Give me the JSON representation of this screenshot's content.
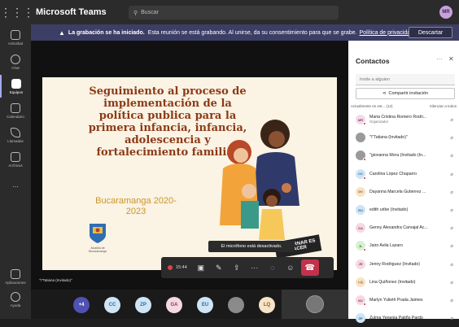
{
  "app": {
    "title": "Microsoft Teams",
    "search_placeholder": "Buscar",
    "user_initials": "MR"
  },
  "rail": [
    {
      "label": "Actividad"
    },
    {
      "label": "Chat"
    },
    {
      "label": "Equipos"
    },
    {
      "label": "Calendario"
    },
    {
      "label": "Llamadas"
    },
    {
      "label": "Archivos"
    },
    {
      "label": "..."
    }
  ],
  "rail_bottom": [
    {
      "label": "Aplicaciones"
    },
    {
      "label": "Ayuda"
    }
  ],
  "banner": {
    "bold": "La grabación se ha iniciado.",
    "text": "Esta reunión se está grabando. Al unirse, da su consentimiento para que se grabe.",
    "link": "Política de privacidad",
    "button": "Descartar"
  },
  "slide": {
    "title": "Seguimiento al proceso de implementación de la política publica para la primera infancia, infancia, adolescencia y fortalecimiento familiar",
    "subtitle": "Bucaramanga 2020-2023",
    "crest_label": "Alcaldía de Bucaramanga",
    "gob": "GOBERNAR ES HACER"
  },
  "toast": "El micrófono está desactivado.",
  "controls": {
    "timer": "15:44"
  },
  "caption": "\"\\\"Tatiana (Invitado)\"",
  "strip": [
    {
      "label": "+4",
      "color": "#4f52b2"
    },
    {
      "label": "CC",
      "color": "#cfe4f4"
    },
    {
      "label": "ZP",
      "color": "#cfe4f4"
    },
    {
      "label": "GA",
      "color": "#f4d9e2"
    },
    {
      "label": "EU",
      "color": "#cfe4f4"
    },
    {
      "label": "",
      "color": "#8a8a8a"
    },
    {
      "label": "LQ",
      "color": "#f7e3c7"
    }
  ],
  "panel": {
    "title": "Contactos",
    "invite_placeholder": "Invite a alguien",
    "share_label": "Compartir invitación",
    "section_label": "Actualmente en est... (12)",
    "mute_all": "Silenciar a todos",
    "people": [
      {
        "initials": "MR",
        "name": "Maria Cristina Romero Rodri...",
        "role": "Organizador",
        "bg": "#f0dbe8",
        "fg": "#8a3f6e",
        "dot": true
      },
      {
        "initials": "",
        "name": "\"\\\"Tatiana (Invitado)\"",
        "role": "",
        "bg": "#9a9a9a",
        "fg": "#fff",
        "dot": false
      },
      {
        "initials": "",
        "name": "\"giovanna Mora (Invitado (In...",
        "role": "",
        "bg": "#9a9a9a",
        "fg": "#fff",
        "dot": true
      },
      {
        "initials": "CC",
        "name": "Carolina Lopez Chaparro",
        "role": "",
        "bg": "#cfe4f4",
        "fg": "#2a6a9a",
        "dot": true
      },
      {
        "initials": "DV",
        "name": "Dayanna Marcela Gutierrez ...",
        "role": "",
        "bg": "#f7e3c7",
        "fg": "#8a5a1a",
        "dot": false
      },
      {
        "initials": "EU",
        "name": "edith uribe (Invitado)",
        "role": "",
        "bg": "#cfe4f4",
        "fg": "#2a6a9a",
        "dot": false
      },
      {
        "initials": "GA",
        "name": "Genny Alexandra Carvajal Ac...",
        "role": "",
        "bg": "#f4d9e2",
        "fg": "#9a3a5a",
        "dot": false
      },
      {
        "initials": "JL",
        "name": "Jairo Avila Lazaro",
        "role": "",
        "bg": "#d9f0d4",
        "fg": "#3a7a2a",
        "dot": true
      },
      {
        "initials": "JR",
        "name": "Jenny Rodriguez (Invitado)",
        "role": "",
        "bg": "#f4d9e2",
        "fg": "#9a3a5a",
        "dot": false
      },
      {
        "initials": "LQ",
        "name": "Lina Quiñonez (Invitado)",
        "role": "",
        "bg": "#f7e3c7",
        "fg": "#8a5a1a",
        "dot": false
      },
      {
        "initials": "MJ",
        "name": "Marlyn Yulieth Prada Jaimes",
        "role": "",
        "bg": "#f4d9e2",
        "fg": "#9a3a5a",
        "dot": true
      },
      {
        "initials": "ZP",
        "name": "Zulma Yenenia Patiño Pardo",
        "role": "",
        "bg": "#cfe4f4",
        "fg": "#2a6a9a",
        "dot": false
      }
    ]
  }
}
